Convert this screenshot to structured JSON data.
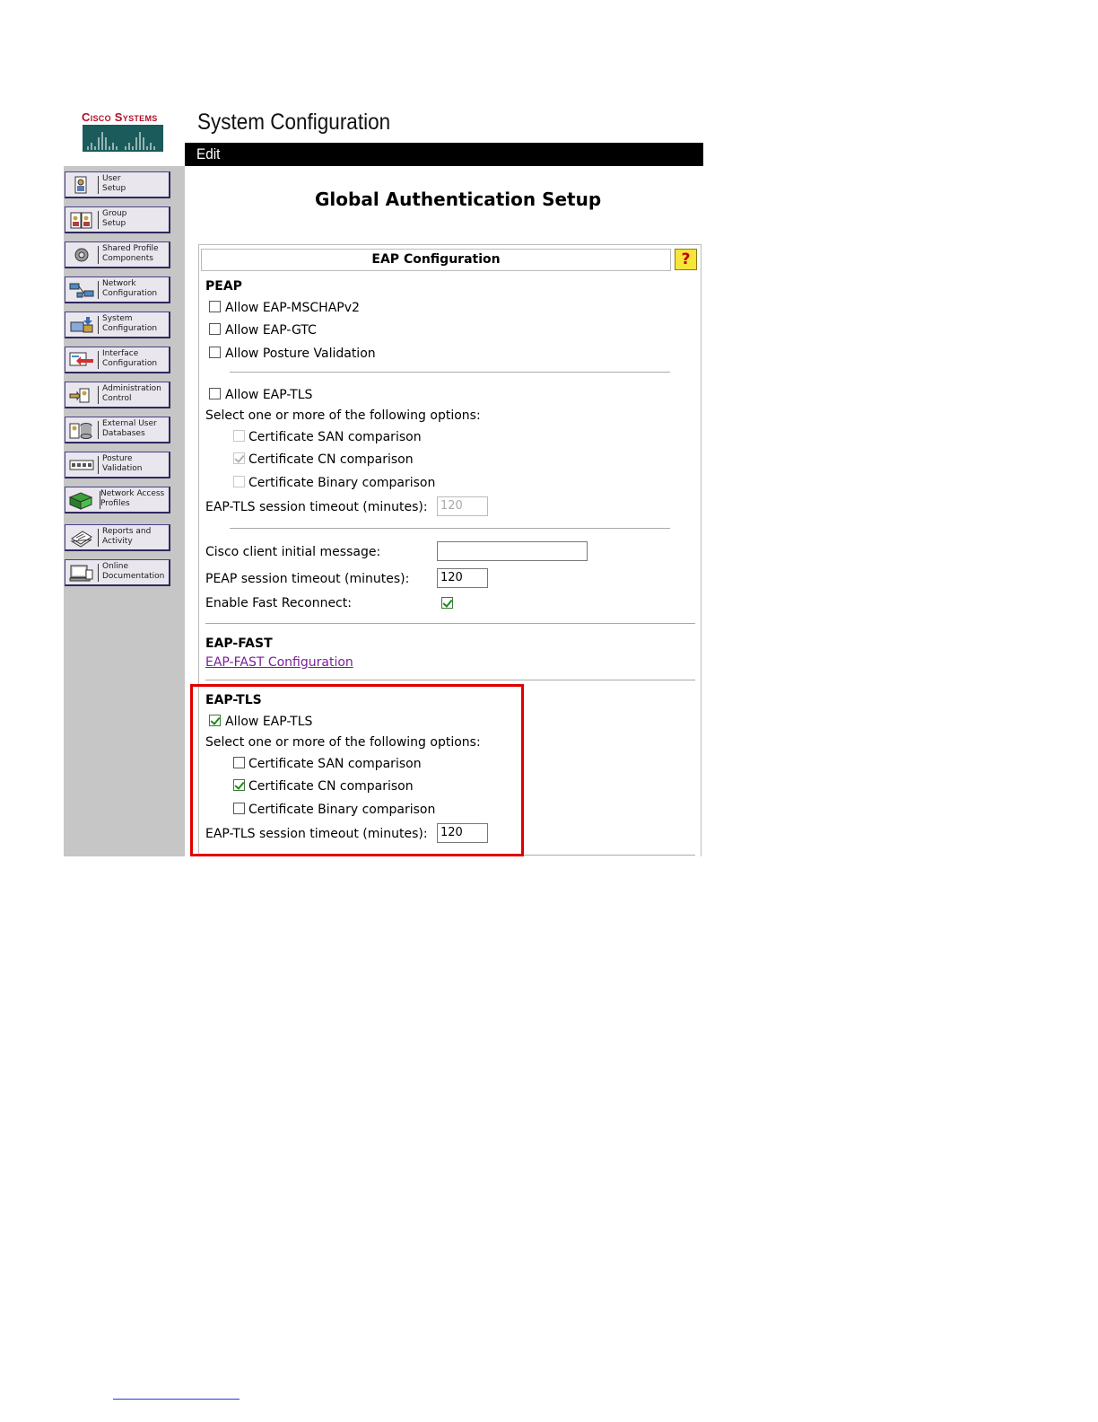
{
  "header": {
    "brand": "Cisco Systems",
    "page_title": "System Configuration",
    "edit_label": "Edit"
  },
  "sidebar": {
    "items": [
      {
        "label": "User\nSetup",
        "icon": "user-setup-icon"
      },
      {
        "label": "Group\nSetup",
        "icon": "group-setup-icon"
      },
      {
        "label": "Shared Profile\nComponents",
        "icon": "shared-profile-icon"
      },
      {
        "label": "Network\nConfiguration",
        "icon": "network-configuration-icon"
      },
      {
        "label": "System\nConfiguration",
        "icon": "system-configuration-icon"
      },
      {
        "label": "Interface\nConfiguration",
        "icon": "interface-configuration-icon"
      },
      {
        "label": "Administration\nControl",
        "icon": "administration-control-icon"
      },
      {
        "label": "External User\nDatabases",
        "icon": "external-user-databases-icon"
      },
      {
        "label": "Posture\nValidation",
        "icon": "posture-validation-icon"
      },
      {
        "label": "Network Access\nProfiles",
        "icon": "network-access-profiles-icon"
      },
      {
        "label": "Reports and\nActivity",
        "icon": "reports-activity-icon"
      },
      {
        "label": "Online\nDocumentation",
        "icon": "online-documentation-icon"
      }
    ]
  },
  "content": {
    "title": "Global Authentication Setup",
    "panel_title": "EAP Configuration",
    "help": "?",
    "peap": {
      "heading": "PEAP",
      "allow_mschapv2": {
        "label": "Allow EAP-MSCHAPv2",
        "checked": false
      },
      "allow_gtc": {
        "label": "Allow EAP-GTC",
        "checked": false
      },
      "allow_posture": {
        "label": "Allow Posture Validation",
        "checked": false
      },
      "allow_eaptls": {
        "label": "Allow EAP-TLS",
        "checked": false
      },
      "options_label": "Select one or more of the following options:",
      "san": {
        "label": "Certificate SAN comparison",
        "checked": false
      },
      "cn": {
        "label": "Certificate CN comparison",
        "checked": true
      },
      "binary": {
        "label": "Certificate Binary comparison",
        "checked": false
      },
      "tls_timeout_label": "EAP-TLS session timeout (minutes):",
      "tls_timeout_value": "120",
      "cisco_msg_label": "Cisco client initial message:",
      "cisco_msg_value": "",
      "peap_timeout_label": "PEAP session timeout (minutes):",
      "peap_timeout_value": "120",
      "fast_reconnect_label": "Enable Fast Reconnect:",
      "fast_reconnect_checked": true
    },
    "eapfast": {
      "heading": "EAP-FAST",
      "link": "EAP-FAST Configuration"
    },
    "eaptls": {
      "heading": "EAP-TLS",
      "allow": {
        "label": "Allow EAP-TLS",
        "checked": true
      },
      "options_label": "Select one or more of the following options:",
      "san": {
        "label": "Certificate SAN comparison",
        "checked": false
      },
      "cn": {
        "label": "Certificate CN comparison",
        "checked": true
      },
      "binary": {
        "label": "Certificate Binary comparison",
        "checked": false
      },
      "timeout_label": "EAP-TLS session timeout (minutes):",
      "timeout_value": "120"
    }
  },
  "colors": {
    "highlight": "#e00000",
    "link": "#7a1f9a",
    "brand": "#b0102a"
  }
}
